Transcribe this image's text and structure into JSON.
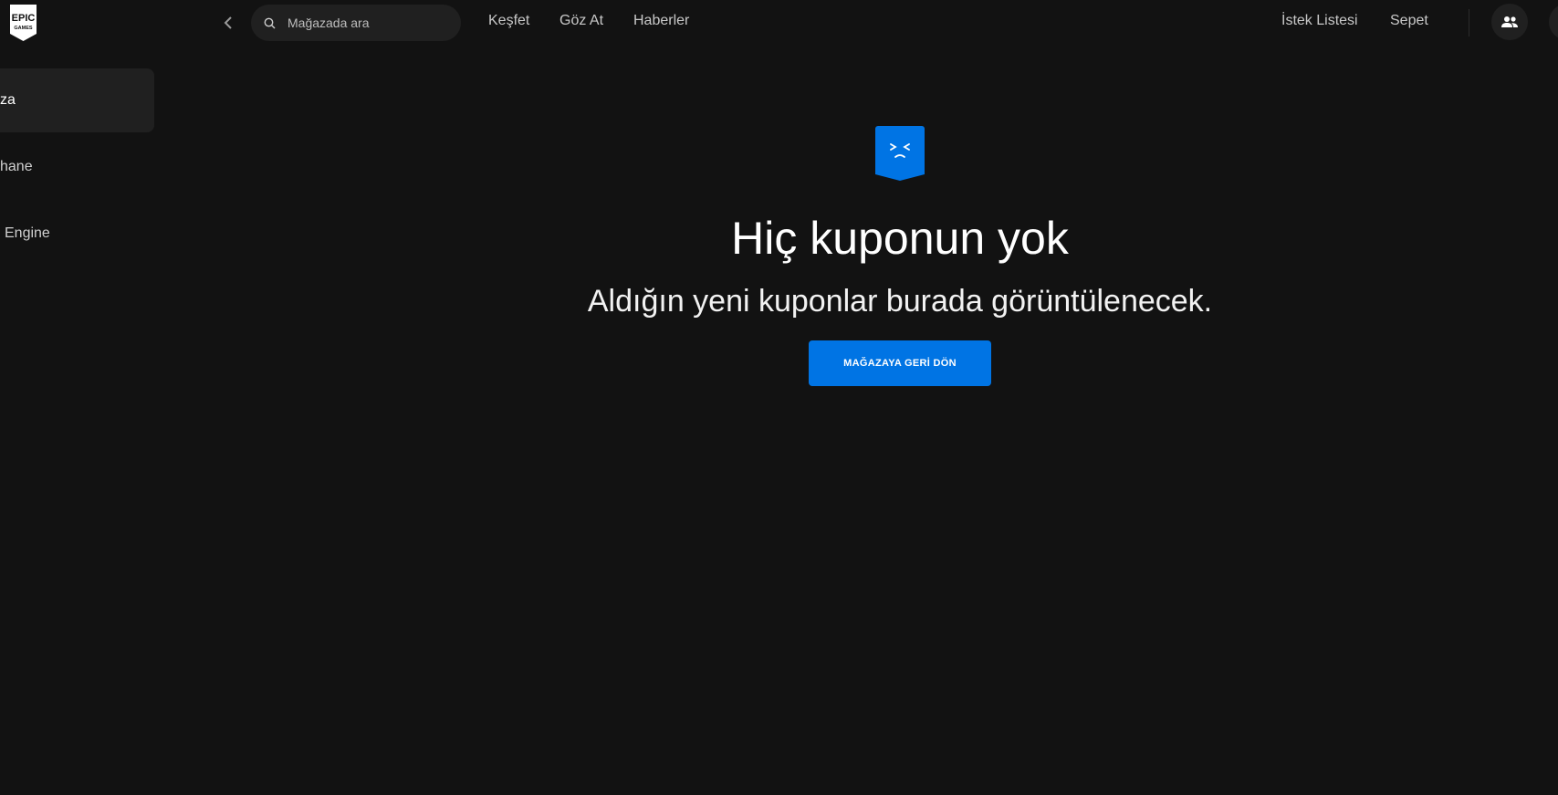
{
  "colors": {
    "background": "#121212",
    "surface": "#202020",
    "accent": "#0074e4",
    "text": "#ffffff",
    "muted_text": "#c8c8c8"
  },
  "header": {
    "logo_text_top": "EPIC",
    "logo_text_bottom": "GAMES",
    "back_icon": "chevron-left-icon",
    "search": {
      "placeholder": "Mağazada ara",
      "icon": "search-icon"
    },
    "nav": [
      {
        "label": "Keşfet"
      },
      {
        "label": "Göz At"
      },
      {
        "label": "Haberler"
      }
    ],
    "wishlist_label": "İstek Listesi",
    "cart_label": "Sepet",
    "friends_icon": "friends-icon"
  },
  "sidebar": {
    "items": [
      {
        "label": "za",
        "active": true
      },
      {
        "label": "hane",
        "active": false
      },
      {
        "label": "Engine",
        "active": false
      }
    ]
  },
  "main": {
    "empty_icon": "sad-ticket-icon",
    "title": "Hiç kuponun yok",
    "subtitle": "Aldığın yeni kuponlar burada görüntülenecek.",
    "cta_label": "MAĞAZAYA GERİ DÖN"
  }
}
